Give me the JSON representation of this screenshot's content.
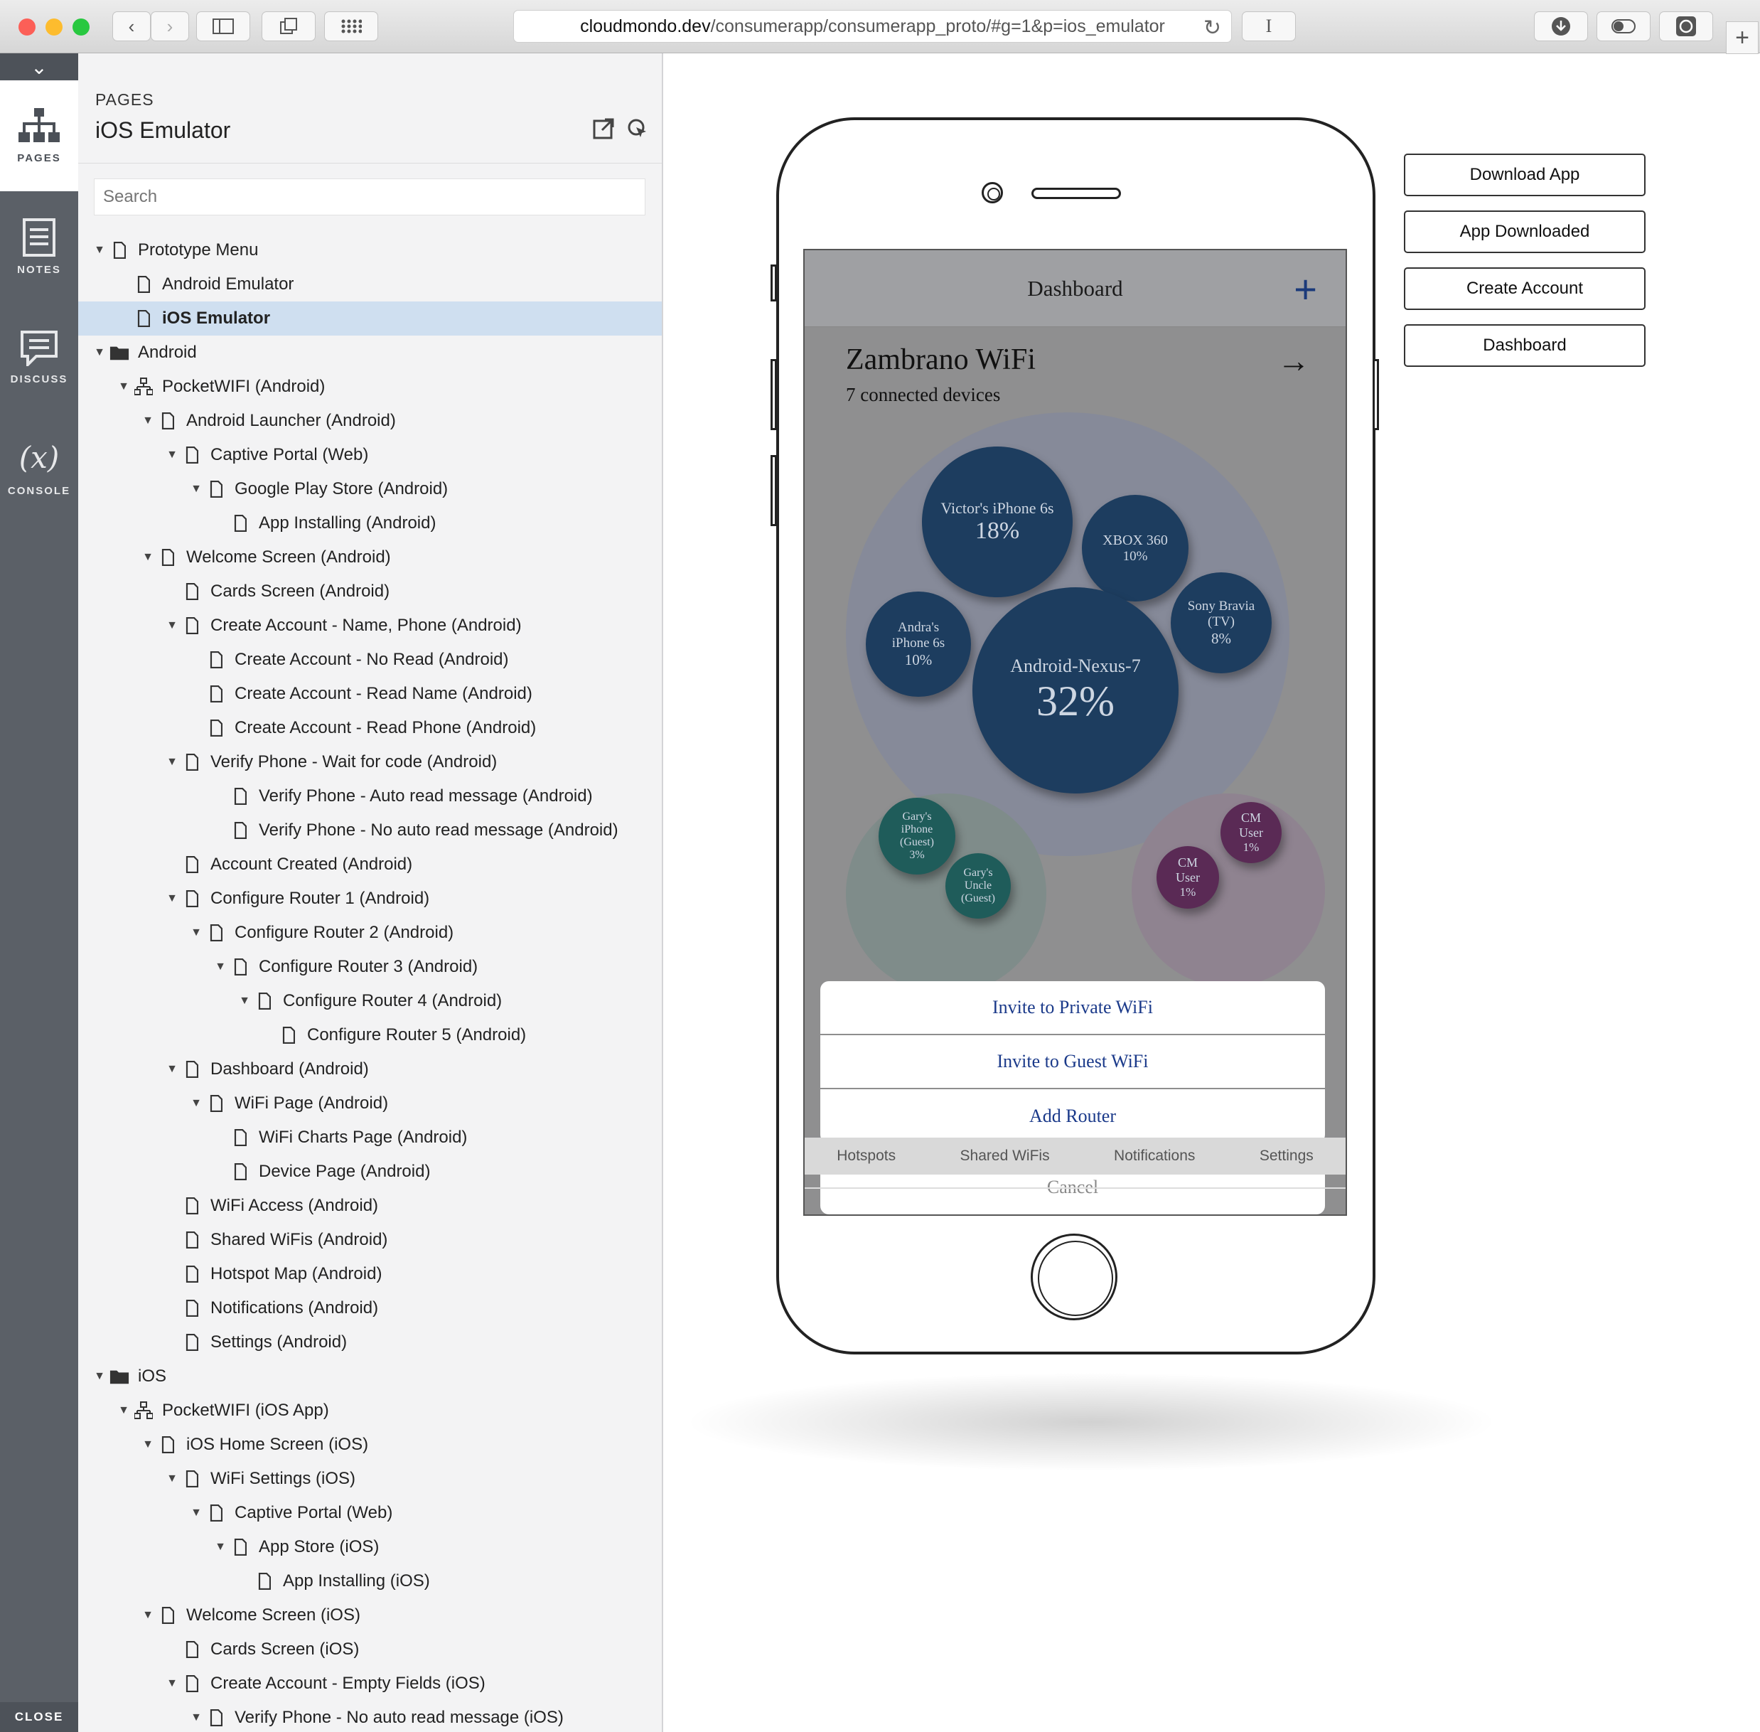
{
  "browser": {
    "url_domain": "cloudmondo.dev",
    "url_path": "/consumerapp/consumerapp_proto/#g=1&p=ios_emulator",
    "reader_glyph": "I"
  },
  "rail": {
    "items": [
      {
        "label": "PAGES",
        "icon": "sitemap-icon"
      },
      {
        "label": "NOTES",
        "icon": "notes-icon"
      },
      {
        "label": "DISCUSS",
        "icon": "discuss-icon"
      },
      {
        "label": "CONSOLE",
        "glyph": "(x)"
      }
    ],
    "close_label": "CLOSE"
  },
  "panel": {
    "section": "PAGES",
    "title": "iOS Emulator",
    "search_placeholder": "Search"
  },
  "tree": [
    {
      "label": "Prototype Menu",
      "type": "page"
    },
    {
      "label": "Android Emulator",
      "type": "page"
    },
    {
      "label": "iOS Emulator",
      "type": "page",
      "selected": true
    },
    {
      "label": "Android",
      "type": "folder"
    },
    {
      "label": "PocketWIFI (Android)",
      "type": "flow"
    },
    {
      "label": "Android Launcher (Android)",
      "type": "page"
    },
    {
      "label": "Captive Portal (Web)",
      "type": "page"
    },
    {
      "label": "Google Play Store (Android)",
      "type": "page"
    },
    {
      "label": "App Installing (Android)",
      "type": "page"
    },
    {
      "label": "Welcome Screen (Android)",
      "type": "page"
    },
    {
      "label": "Cards Screen (Android)",
      "type": "page"
    },
    {
      "label": "Create Account - Name, Phone (Android)",
      "type": "page"
    },
    {
      "label": "Create Account - No Read (Android)",
      "type": "page"
    },
    {
      "label": "Create Account - Read Name (Android)",
      "type": "page"
    },
    {
      "label": "Create Account - Read Phone (Android)",
      "type": "page"
    },
    {
      "label": "Verify Phone - Wait for code (Android)",
      "type": "page"
    },
    {
      "label": "Verify Phone - Auto read message (Android)",
      "type": "page"
    },
    {
      "label": "Verify Phone - No auto read message (Android)",
      "type": "page"
    },
    {
      "label": "Account Created (Android)",
      "type": "page"
    },
    {
      "label": "Configure Router 1 (Android)",
      "type": "page"
    },
    {
      "label": "Configure Router 2 (Android)",
      "type": "page"
    },
    {
      "label": "Configure Router 3 (Android)",
      "type": "page"
    },
    {
      "label": "Configure Router 4 (Android)",
      "type": "page"
    },
    {
      "label": "Configure Router 5 (Android)",
      "type": "page"
    },
    {
      "label": "Dashboard (Android)",
      "type": "page"
    },
    {
      "label": "WiFi Page (Android)",
      "type": "page"
    },
    {
      "label": "WiFi Charts Page (Android)",
      "type": "page"
    },
    {
      "label": "Device Page (Android)",
      "type": "page"
    },
    {
      "label": "WiFi Access (Android)",
      "type": "page"
    },
    {
      "label": "Shared WiFis (Android)",
      "type": "page"
    },
    {
      "label": "Hotspot Map (Android)",
      "type": "page"
    },
    {
      "label": "Notifications (Android)",
      "type": "page"
    },
    {
      "label": "Settings (Android)",
      "type": "page"
    },
    {
      "label": "iOS",
      "type": "folder"
    },
    {
      "label": "PocketWIFI (iOS App)",
      "type": "flow"
    },
    {
      "label": "iOS Home Screen (iOS)",
      "type": "page"
    },
    {
      "label": "WiFi Settings (iOS)",
      "type": "page"
    },
    {
      "label": "Captive Portal (Web)",
      "type": "page"
    },
    {
      "label": "App Store (iOS)",
      "type": "page"
    },
    {
      "label": "App Installing (iOS)",
      "type": "page"
    },
    {
      "label": "Welcome Screen (iOS)",
      "type": "page"
    },
    {
      "label": "Cards Screen (iOS)",
      "type": "page"
    },
    {
      "label": "Create Account - Empty Fields (iOS)",
      "type": "page"
    },
    {
      "label": "Verify Phone - No auto read message (iOS)",
      "type": "page"
    }
  ],
  "side_buttons": [
    "Download App",
    "App Downloaded",
    "Create Account",
    "Dashboard"
  ],
  "app": {
    "header_title": "Dashboard",
    "network_name": "Zambrano WiFi",
    "connected": "7 connected devices",
    "devices": [
      {
        "name": "Victor's iPhone 6s",
        "pct": "18%"
      },
      {
        "name": "XBOX 360",
        "pct": "10%"
      },
      {
        "name": "Sony Bravia (TV)",
        "pct": "8%"
      },
      {
        "name": "Andra's iPhone 6s",
        "pct": "10%"
      },
      {
        "name": "Android-Nexus-7",
        "pct": "32%"
      },
      {
        "name": "Gary's iPhone (Guest)",
        "pct": "3%"
      },
      {
        "name": "Gary's Uncle (Guest)",
        "pct": ""
      },
      {
        "name": "CM User",
        "pct": "1%"
      },
      {
        "name": "CM User",
        "pct": "1%"
      }
    ],
    "action_sheet": [
      "Invite to Private WiFi",
      "Invite to Guest WiFi",
      "Add Router"
    ],
    "cancel_label": "Cancel",
    "tabs": [
      "Hotspots",
      "Shared WiFis",
      "Notifications",
      "Settings"
    ]
  },
  "colors": {
    "bubble_private": "#1d3d5f",
    "bubble_guest": "#1f5c5a",
    "bubble_cm": "#5a2a55",
    "selection": "#cfdff0",
    "accent": "#1b3a7a"
  }
}
